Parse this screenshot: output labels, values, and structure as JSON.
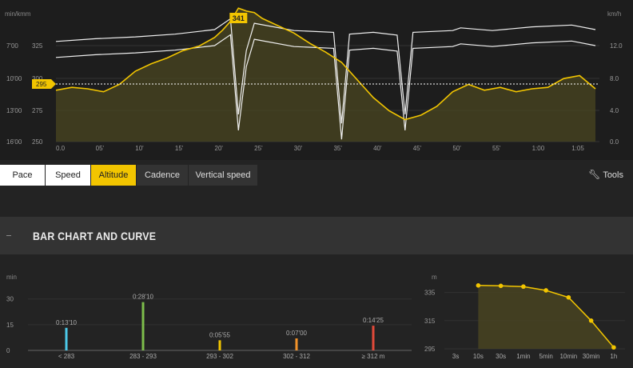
{
  "top_chart": {
    "left_unit": "min/kmm",
    "right_unit": "km/h",
    "pace_ticks": [
      "7'00",
      "10'00",
      "13'00",
      "16'00"
    ],
    "altitude_ticks": [
      "325",
      "300",
      "275",
      "250"
    ],
    "speed_ticks": [
      "12.0",
      "8.0",
      "4.0",
      "0.0"
    ],
    "time_ticks": [
      "0.0",
      "05'",
      "10'",
      "15'",
      "20'",
      "25'",
      "30'",
      "35'",
      "40'",
      "45'",
      "50'",
      "55'",
      "1:00",
      "1:05"
    ],
    "max_altitude_label": "341",
    "current_altitude_label": "295",
    "colors": {
      "altitude": "#f2c500",
      "speed": "#f0f0f0",
      "fill": "#4a4520"
    }
  },
  "chart_data": [
    {
      "type": "area",
      "title": "",
      "xlabel": "",
      "ylabel": "",
      "x_unit": "minutes",
      "ylim_altitude": [
        250,
        340
      ],
      "ylim_speed_kmh": [
        0,
        14.5
      ],
      "series": [
        {
          "name": "Altitude",
          "x": [
            0,
            2,
            4,
            6,
            8,
            10,
            12,
            14,
            16,
            18,
            20,
            21,
            22,
            23,
            24,
            25,
            26,
            28,
            30,
            32,
            34,
            36,
            38,
            40,
            42,
            44,
            46,
            48,
            50,
            52,
            54,
            56,
            58,
            60,
            62,
            64,
            66,
            68
          ],
          "values": [
            285,
            287,
            286,
            284,
            289,
            298,
            303,
            307,
            312,
            315,
            321,
            326,
            332,
            341,
            339,
            338,
            334,
            329,
            324,
            317,
            311,
            304,
            292,
            280,
            271,
            265,
            268,
            274,
            284,
            289,
            285,
            287,
            284,
            286,
            287,
            293,
            295,
            286
          ]
        },
        {
          "name": "Speed",
          "x": [
            0,
            5,
            10,
            15,
            20,
            22,
            23,
            24,
            25,
            30,
            35,
            36,
            37,
            40,
            43,
            44,
            45,
            50,
            51,
            55,
            60,
            65,
            68
          ],
          "values": [
            11,
            11.3,
            11.5,
            11.8,
            12.3,
            13.5,
            3,
            10,
            13,
            12.2,
            12,
            2,
            11.8,
            12,
            11.7,
            3,
            12,
            12.2,
            12.5,
            12.2,
            12.6,
            12.8,
            12.3
          ]
        }
      ]
    },
    {
      "type": "bar",
      "title": "BAR CHART AND CURVE",
      "ylabel": "min",
      "xlabel": "",
      "yticks": [
        "30",
        "15",
        "0"
      ],
      "ylim": [
        0,
        42
      ],
      "categories": [
        "< 283",
        "283 - 293",
        "293 - 302",
        "302 - 312",
        "≥ 312 m"
      ],
      "values": [
        13.17,
        28.17,
        5.92,
        7.0,
        14.42
      ],
      "value_labels": [
        "0:13'10",
        "0:28'10",
        "0:05'55",
        "0:07'00",
        "0:14'25"
      ],
      "colors": [
        "#4cc9e8",
        "#7dbd4b",
        "#f2c500",
        "#f2922a",
        "#e24a3a"
      ]
    },
    {
      "type": "line",
      "title": "",
      "ylabel": "m",
      "xlabel": "",
      "yticks": [
        "335",
        "315",
        "295"
      ],
      "ylim": [
        295,
        345
      ],
      "categories": [
        "3s",
        "10s",
        "30s",
        "1min",
        "5min",
        "10min",
        "30min",
        "1h"
      ],
      "x": [
        "10s",
        "30s",
        "1min",
        "5min",
        "10min",
        "30min",
        "1h"
      ],
      "values": [
        340,
        339.7,
        339.2,
        336.5,
        331.5,
        315,
        296
      ]
    }
  ],
  "controls": {
    "buttons": [
      "Pace",
      "Speed",
      "Altitude",
      "Cadence",
      "Vertical speed"
    ],
    "active": "Altitude",
    "tools_label": "Tools"
  },
  "section": {
    "title": "BAR CHART AND CURVE"
  },
  "bar_chart": {
    "y_unit": "min"
  },
  "curve_chart": {
    "y_unit": "m"
  }
}
